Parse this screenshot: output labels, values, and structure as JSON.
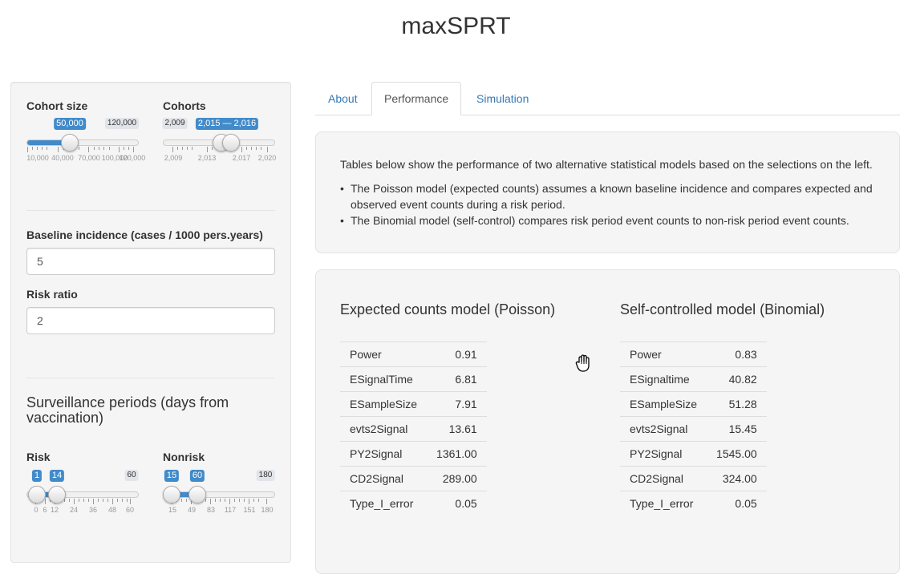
{
  "app": {
    "title": "maxSPRT"
  },
  "sidebar": {
    "cohort_size": {
      "label": "Cohort size",
      "value": "50,000",
      "max_label": "120,000",
      "min": 10000,
      "max": 120000,
      "current": 50000,
      "tick_labels": [
        "10,000",
        "40,000",
        "70,000",
        "100,000",
        "120,000"
      ]
    },
    "cohorts": {
      "label": "Cohorts",
      "min_label": "2,009",
      "range_label": "2,015 — 2,016",
      "min": 2009,
      "max": 2020,
      "low": 2015,
      "high": 2016,
      "tick_labels": [
        "2,009",
        "2,013",
        "2,017",
        "2,020"
      ]
    },
    "baseline": {
      "label": "Baseline incidence (cases / 1000 pers.years)",
      "value": "5"
    },
    "risk_ratio": {
      "label": "Risk ratio",
      "value": "2"
    },
    "surveillance": {
      "title": "Surveillance periods (days from vaccination)",
      "risk": {
        "label": "Risk",
        "low_label": "1",
        "high_label": "14",
        "max_label": "60",
        "min": 0,
        "max": 60,
        "low": 1,
        "high": 14,
        "tick_labels": [
          "0",
          "6",
          "12",
          "24",
          "36",
          "48",
          "60"
        ]
      },
      "nonrisk": {
        "label": "Nonrisk",
        "low_label": "15",
        "high_label": "60",
        "max_label": "180",
        "min": 15,
        "max": 180,
        "low": 15,
        "high": 60,
        "tick_labels": [
          "15",
          "49",
          "83",
          "117",
          "151",
          "180"
        ]
      }
    }
  },
  "tabs": [
    {
      "label": "About",
      "active": false
    },
    {
      "label": "Performance",
      "active": true
    },
    {
      "label": "Simulation",
      "active": false
    }
  ],
  "about": {
    "intro": "Tables below show the performance of two alternative statistical models based on the selections on the left.",
    "bullets": [
      "The Poisson model (expected counts) assumes a known baseline incidence and compares expected and observed event counts during a risk period.",
      "The Binomial model (self-control) compares risk period event counts to non-risk period event counts."
    ]
  },
  "poisson": {
    "title": "Expected counts model (Poisson)",
    "rows": [
      {
        "name": "Power",
        "value": "0.91"
      },
      {
        "name": "ESignalTime",
        "value": "6.81"
      },
      {
        "name": "ESampleSize",
        "value": "7.91"
      },
      {
        "name": "evts2Signal",
        "value": "13.61"
      },
      {
        "name": "PY2Signal",
        "value": "1361.00"
      },
      {
        "name": "CD2Signal",
        "value": "289.00"
      },
      {
        "name": "Type_I_error",
        "value": "0.05"
      }
    ]
  },
  "binomial": {
    "title": "Self-controlled model (Binomial)",
    "rows": [
      {
        "name": "Power",
        "value": "0.83"
      },
      {
        "name": "ESignaltime",
        "value": "40.82"
      },
      {
        "name": "ESampleSize",
        "value": "51.28"
      },
      {
        "name": "evts2Signal",
        "value": "15.45"
      },
      {
        "name": "PY2Signal",
        "value": "1545.00"
      },
      {
        "name": "CD2Signal",
        "value": "324.00"
      },
      {
        "name": "Type_I_error",
        "value": "0.05"
      }
    ]
  },
  "colors": {
    "accent": "#428bca",
    "link": "#337ab7",
    "well": "#f5f5f5"
  }
}
